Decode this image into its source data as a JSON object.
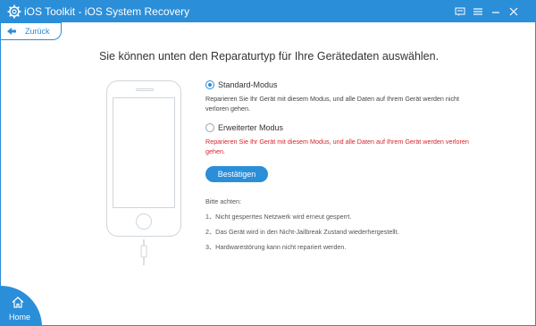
{
  "window": {
    "title": "iOS Toolkit - iOS System Recovery",
    "icons": [
      "gear-app-icon",
      "feedback-icon",
      "menu-icon",
      "minimize-icon",
      "close-icon"
    ]
  },
  "nav": {
    "back_label": "Zurück",
    "home_label": "Home"
  },
  "main": {
    "heading": "Sie können unten den Reparaturtyp für Ihre Gerätedaten auswählen.",
    "options": [
      {
        "label": "Standard-Modus",
        "selected": true,
        "description": "Reparieren Sie Ihr Gerät mit diesem Modus, und alle Daten auf Ihrem Gerät werden nicht verloren gehen."
      },
      {
        "label": "Erweiterter Modus",
        "selected": false,
        "description": "Reparieren Sie Ihr Gerät mit diesem Modus, und alle Daten auf Ihrem Gerät werden verloren gehen."
      }
    ],
    "confirm_label": "Bestätigen",
    "notes_title": "Bitte achten:",
    "notes": [
      "1、Nicht gesperrtes Netzwerk wird erneut gesperrt.",
      "2、Das Gerät wird in den Nicht-Jailbreak Zustand wiederhergestellt.",
      "3、Hardwarestörung kann nicht repariert werden."
    ]
  },
  "colors": {
    "accent": "#2b8ed9",
    "warning": "#d8242b"
  }
}
